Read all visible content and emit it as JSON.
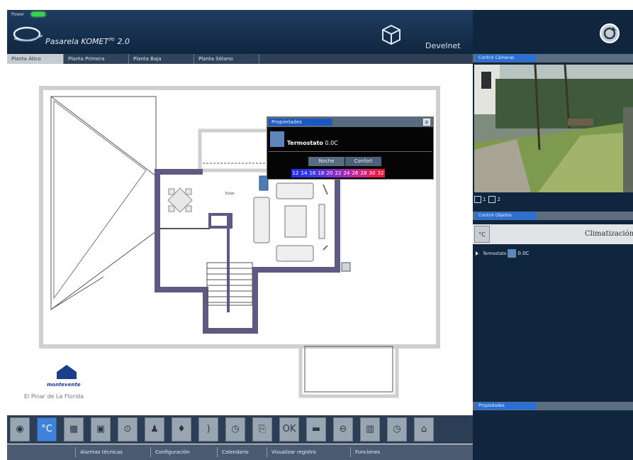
{
  "header": {
    "power_label": "Power",
    "app_title": "Pasarela KOMET",
    "app_version_sup": "(R)",
    "app_version": " 2.0",
    "user_name": "Develnet"
  },
  "floor_tabs": [
    {
      "label": "Planta Ático",
      "active": true
    },
    {
      "label": "Planta Primera",
      "active": false
    },
    {
      "label": "Planta Baja",
      "active": false
    },
    {
      "label": "Planta Sótano",
      "active": false
    }
  ],
  "properties_popup": {
    "title": "Propiedades",
    "close_glyph": "x",
    "device_name": "Termostato",
    "device_value": " 0.0C",
    "modes": [
      "Noche",
      "Confort"
    ],
    "temps": [
      "12",
      "14",
      "16",
      "18",
      "20",
      "22",
      "24",
      "26",
      "28",
      "30",
      "32"
    ],
    "temp_colors": [
      "#2a2fe0",
      "#2c35e8",
      "#3e38e6",
      "#5a33dc",
      "#7830d2",
      "#902cc4",
      "#a82ab4",
      "#bf2799",
      "#d3237d",
      "#e01e5a",
      "#e81c3a"
    ]
  },
  "brand": {
    "name": "montevente",
    "place": "El Pinar de La Florida"
  },
  "toolbar": {
    "icons": [
      "camera-icon",
      "thermometer-icon",
      "blinds-icon",
      "window-icon",
      "socket-icon",
      "person-icon",
      "lamp-icon",
      "moon-icon",
      "clock-icon",
      "scene-icon",
      "ok-icon",
      "minus-icon",
      "no-entry-icon",
      "panel-icon",
      "timer-icon",
      "home-icon"
    ],
    "glyphs": [
      "◉",
      "°C",
      "▦",
      "▣",
      "⊙",
      "♟",
      "♦",
      ")",
      "◷",
      "⎘",
      "OK",
      "▬",
      "⊖",
      "▥",
      "◷",
      "⌂"
    ],
    "selected_index": 1
  },
  "bottom_menu": [
    "Alarmas técnicas",
    "Configuración",
    "Calendario",
    "Visualizar registro",
    "Funciones"
  ],
  "right_panel": {
    "camera_title": "Control Cámaras",
    "cam_labels": [
      "1",
      "2"
    ],
    "control_title": "Control Objetos",
    "climate_label": "Climatización",
    "climate_icon_glyph": "°C",
    "thermostat_name": "Termostato",
    "thermostat_value": "0.0C",
    "properties_title": "Propiedades"
  },
  "floorplan_text": {
    "room_label": "Estar"
  }
}
